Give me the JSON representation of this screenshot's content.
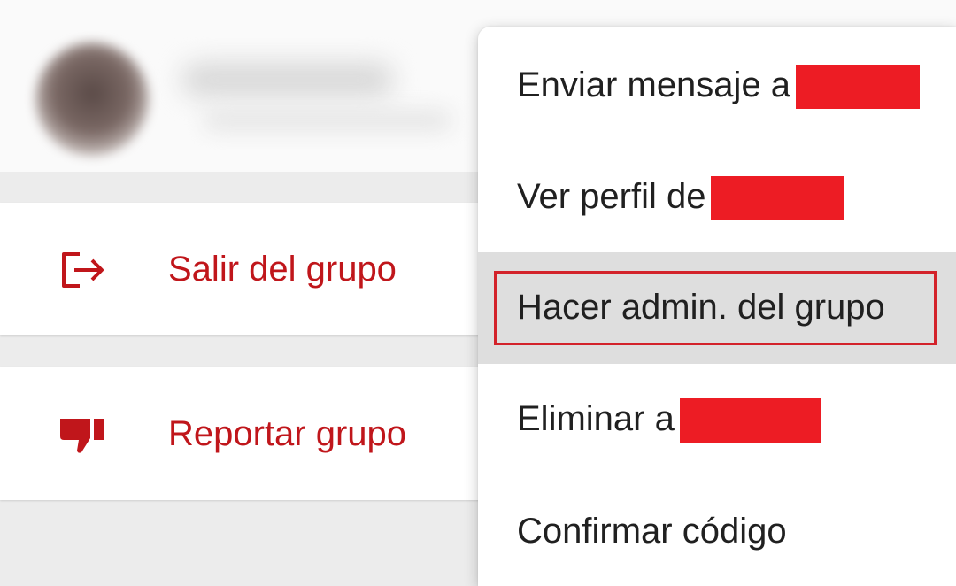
{
  "header": {
    "avatar_icon": "blurred-avatar"
  },
  "actions": {
    "leave_group": {
      "label": "Salir del grupo",
      "icon": "exit-icon"
    },
    "report_group": {
      "label": "Reportar grupo",
      "icon": "thumbs-down-icon"
    }
  },
  "context_menu": {
    "items": [
      {
        "label": "Enviar mensaje a",
        "redacted": true
      },
      {
        "label": "Ver perfil de",
        "redacted": true
      },
      {
        "label": "Hacer admin. del grupo",
        "highlighted": true
      },
      {
        "label": "Eliminar a",
        "redacted": true
      },
      {
        "label": "Confirmar código"
      }
    ]
  },
  "colors": {
    "accent": "#c0161b",
    "redaction": "#ed1c24",
    "highlight_border": "#d3222a",
    "selected_bg": "#dedede"
  }
}
